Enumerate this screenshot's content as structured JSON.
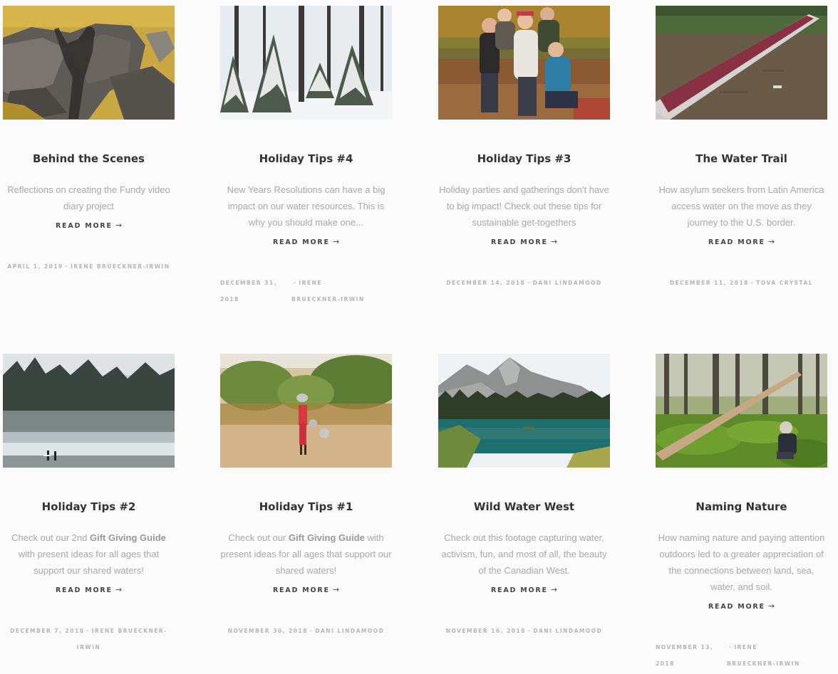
{
  "posts": [
    {
      "title": "Behind the Scenes",
      "excerpt": "Reflections on creating the Fundy video diary project",
      "read_more": "READ MORE",
      "date": "APRIL 1, 2019",
      "author": "IRENE BRUECKNER-IRWIN"
    },
    {
      "title": "Holiday Tips #4",
      "excerpt": "New Years Resolutions can have a big impact on our water resources. This is why you should make one...",
      "read_more": "READ MORE",
      "date": "DECEMBER 31, 2018",
      "author": "IRENE BRUECKNER-IRWIN"
    },
    {
      "title": "Holiday Tips #3",
      "excerpt": "Holiday parties and gatherings don't have to big impact! Check out these tips for sustainable get-togethers",
      "read_more": "READ MORE",
      "date": "DECEMBER 14, 2018",
      "author": "DANI LINDAMOOD"
    },
    {
      "title": "The Water Trail",
      "excerpt": "How asylum seekers from Latin America access water on the move as they journey to the U.S. border.",
      "read_more": "READ MORE",
      "date": "DECEMBER 11, 2018",
      "author": "TOVA CRYSTAL"
    },
    {
      "title": "Holiday Tips #2",
      "excerpt_pre": "Check out our 2nd ",
      "excerpt_bold": "Gift Giving Guide",
      "excerpt_post": " with present ideas for all ages that support our shared waters!",
      "read_more": "READ MORE",
      "date": "DECEMBER 7, 2018",
      "author": "IRENE BRUECKNER-IRWIN"
    },
    {
      "title": "Holiday Tips #1",
      "excerpt_pre": "Check out our ",
      "excerpt_bold": "Gift Giving Guide",
      "excerpt_post": " with present ideas for all ages that support our shared waters!",
      "read_more": "READ MORE",
      "date": "NOVEMBER 30, 2018",
      "author": "DANI LINDAMOOD"
    },
    {
      "title": "Wild Water West",
      "excerpt": "Check out this footage capturing water, activism, fun, and most of all, the beauty of the Canadian West.",
      "read_more": "READ MORE",
      "date": "NOVEMBER 16, 2018",
      "author": "DANI LINDAMOOD"
    },
    {
      "title": "Naming Nature",
      "excerpt": "How naming nature and paying attention outdoors led to a greater appreciation of the connections between land, sea, water, and soil.",
      "read_more": "READ MORE",
      "date": "NOVEMBER 13, 2018",
      "author": "IRENE BRUECKNER-IRWIN"
    }
  ],
  "meta_separator": "·",
  "arrow": "→"
}
